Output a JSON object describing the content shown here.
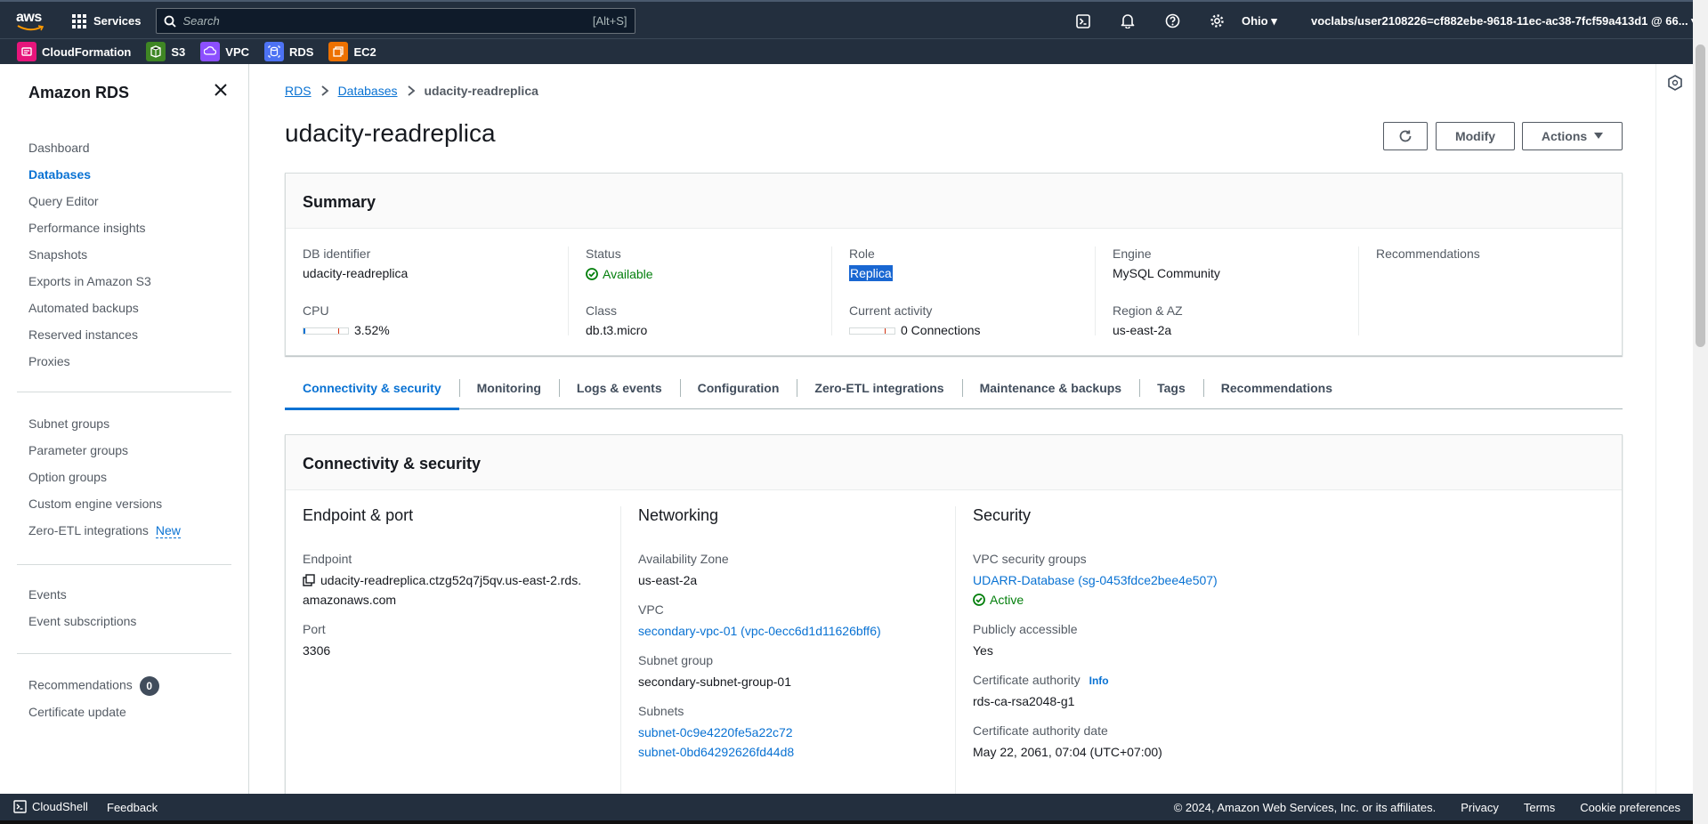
{
  "topnav": {
    "services_label": "Services",
    "search_placeholder": "Search",
    "search_shortcut": "[Alt+S]",
    "region": "Ohio",
    "account": "voclabs/user2108226=cf882ebe-9618-11ec-ac38-7fcf59a413d1 @ 66..."
  },
  "favorites": [
    {
      "label": "CloudFormation",
      "color": "#e7157b",
      "icon": "cloudformation-icon"
    },
    {
      "label": "S3",
      "color": "#3f8624",
      "icon": "s3-icon"
    },
    {
      "label": "VPC",
      "color": "#8c4fff",
      "icon": "vpc-icon"
    },
    {
      "label": "RDS",
      "color": "#4d72f3",
      "icon": "rds-icon"
    },
    {
      "label": "EC2",
      "color": "#ed7100",
      "icon": "ec2-icon"
    }
  ],
  "sidebar": {
    "title": "Amazon RDS",
    "group1": [
      "Dashboard",
      "Databases",
      "Query Editor",
      "Performance insights",
      "Snapshots",
      "Exports in Amazon S3",
      "Automated backups",
      "Reserved instances",
      "Proxies"
    ],
    "group2": [
      "Subnet groups",
      "Parameter groups",
      "Option groups",
      "Custom engine versions",
      "Zero-ETL integrations"
    ],
    "new_badge": "New",
    "group3": [
      "Events",
      "Event subscriptions"
    ],
    "group4": [
      "Recommendations",
      "Certificate update"
    ],
    "recommendations_count": "0"
  },
  "breadcrumb": {
    "rds": "RDS",
    "databases": "Databases",
    "current": "udacity-readreplica"
  },
  "page": {
    "title": "udacity-readreplica",
    "modify_label": "Modify",
    "actions_label": "Actions"
  },
  "summary": {
    "header": "Summary",
    "db_identifier_label": "DB identifier",
    "db_identifier": "udacity-readreplica",
    "cpu_label": "CPU",
    "cpu_value": "3.52%",
    "cpu_fraction": 0.0352,
    "status_label": "Status",
    "status": "Available",
    "class_label": "Class",
    "class": "db.t3.micro",
    "role_label": "Role",
    "role": "Replica",
    "activity_label": "Current activity",
    "activity": "0 Connections",
    "engine_label": "Engine",
    "engine": "MySQL Community",
    "region_label": "Region & AZ",
    "region": "us-east-2a",
    "recommendations_label": "Recommendations"
  },
  "tabs": [
    "Connectivity & security",
    "Monitoring",
    "Logs & events",
    "Configuration",
    "Zero-ETL integrations",
    "Maintenance & backups",
    "Tags",
    "Recommendations"
  ],
  "connectivity": {
    "header": "Connectivity & security",
    "endpoint_port": {
      "title": "Endpoint & port",
      "endpoint_label": "Endpoint",
      "endpoint_line1": "udacity-readreplica.ctzg52q7j5qv.us-east-2.rds.",
      "endpoint_line2": "amazonaws.com",
      "port_label": "Port",
      "port": "3306"
    },
    "networking": {
      "title": "Networking",
      "az_label": "Availability Zone",
      "az": "us-east-2a",
      "vpc_label": "VPC",
      "vpc": "secondary-vpc-01 (vpc-0ecc6d1d11626bff6)",
      "subnet_group_label": "Subnet group",
      "subnet_group": "secondary-subnet-group-01",
      "subnets_label": "Subnets",
      "subnet1": "subnet-0c9e4220fe5a22c72",
      "subnet2": "subnet-0bd64292626fd44d8"
    },
    "security": {
      "title": "Security",
      "sg_label": "VPC security groups",
      "sg": "UDARR-Database (sg-0453fdce2bee4e507)",
      "sg_status": "Active",
      "public_label": "Publicly accessible",
      "public": "Yes",
      "ca_label": "Certificate authority",
      "info": "Info",
      "ca": "rds-ca-rsa2048-g1",
      "ca_date_label": "Certificate authority date",
      "ca_date": "May 22, 2061, 07:04 (UTC+07:00)"
    }
  },
  "footer": {
    "cloudshell": "CloudShell",
    "feedback": "Feedback",
    "copyright": "© 2024, Amazon Web Services, Inc. or its affiliates.",
    "privacy": "Privacy",
    "terms": "Terms",
    "cookies": "Cookie preferences"
  }
}
